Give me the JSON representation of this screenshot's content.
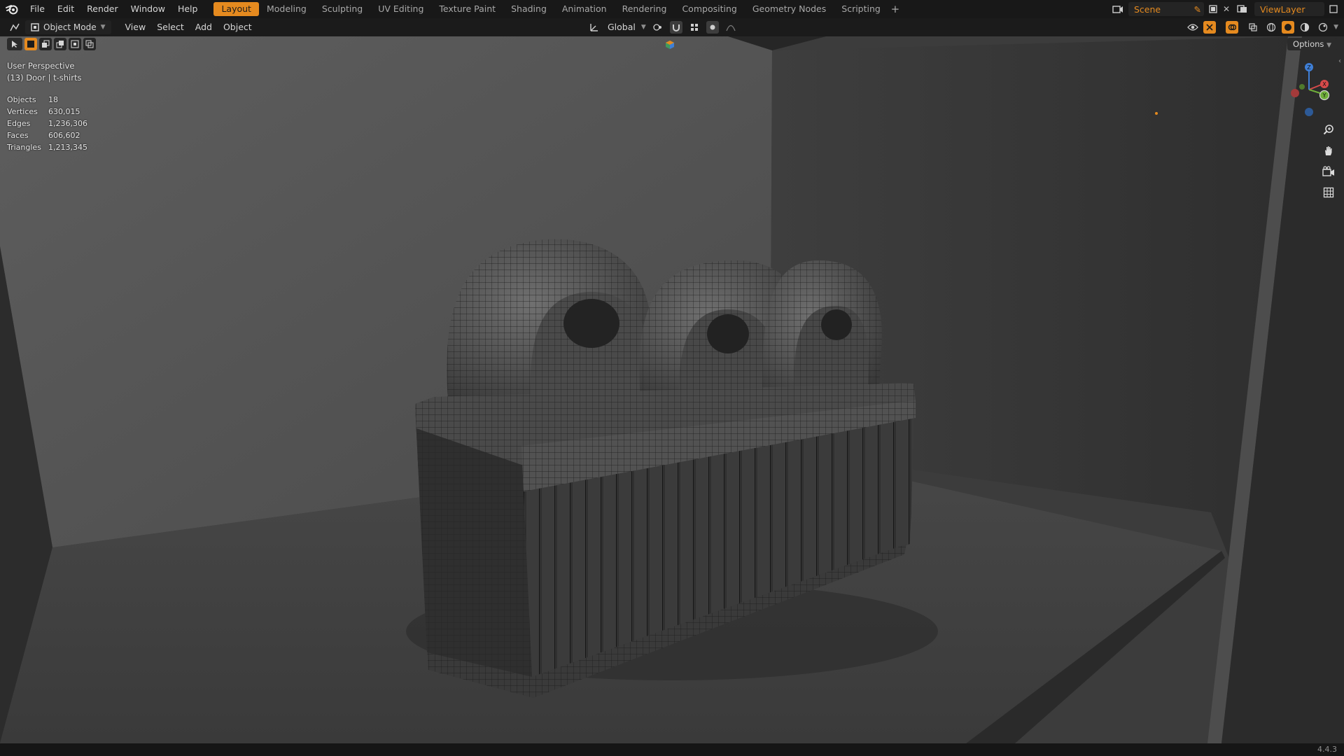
{
  "menu": {
    "items": [
      "File",
      "Edit",
      "Render",
      "Window",
      "Help"
    ]
  },
  "workspaces": {
    "tabs": [
      "Layout",
      "Modeling",
      "Sculpting",
      "UV Editing",
      "Texture Paint",
      "Shading",
      "Animation",
      "Rendering",
      "Compositing",
      "Geometry Nodes",
      "Scripting"
    ],
    "active": "Layout",
    "add_label": "+"
  },
  "scene": {
    "name": "Scene"
  },
  "view_layer": {
    "name": "ViewLayer"
  },
  "header": {
    "mode": "Object Mode",
    "menus": [
      "View",
      "Select",
      "Add",
      "Object"
    ],
    "transform_orientation": "Global"
  },
  "viewport": {
    "view_name": "User Perspective",
    "active_object": "(13) Door | t-shirts",
    "options_label": "Options",
    "stats": [
      {
        "label": "Objects",
        "value": "18"
      },
      {
        "label": "Vertices",
        "value": "630,015"
      },
      {
        "label": "Edges",
        "value": "1,236,306"
      },
      {
        "label": "Faces",
        "value": "606,602"
      },
      {
        "label": "Triangles",
        "value": "1,213,345"
      }
    ],
    "gizmo_axes": {
      "x": "X",
      "y": "Y",
      "z": "Z"
    }
  },
  "status": {
    "version": "4.4.3"
  },
  "colors": {
    "accent": "#e58a1f",
    "axis_x": "#d64a4a",
    "axis_y": "#6fae3a",
    "axis_z": "#3f7fd6"
  },
  "icons": [
    "blender-logo-icon",
    "search-icon",
    "hand-icon",
    "camera-icon",
    "grid-icon",
    "globe-icon",
    "magnet-icon",
    "eye-icon"
  ]
}
